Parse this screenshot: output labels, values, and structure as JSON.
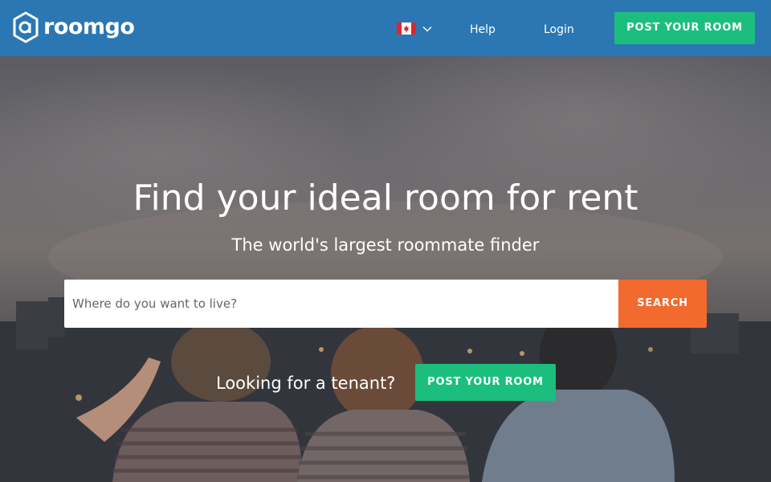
{
  "header": {
    "logo_text": "roomgo",
    "country_flag": "canada-flag-icon",
    "nav": {
      "help_label": "Help",
      "login_label": "Login"
    },
    "post_room_label": "POST YOUR ROOM"
  },
  "hero": {
    "title": "Find your ideal room for rent",
    "subtitle": "The world's largest roommate finder",
    "search": {
      "placeholder": "Where do you want to live?",
      "value": "",
      "button_label": "SEARCH"
    },
    "tenant_prompt": "Looking for a tenant?",
    "post_room_label": "POST YOUR ROOM"
  },
  "colors": {
    "header_bg": "#2b77b3",
    "primary_green": "#1cbe7e",
    "search_orange": "#f26a2e"
  }
}
